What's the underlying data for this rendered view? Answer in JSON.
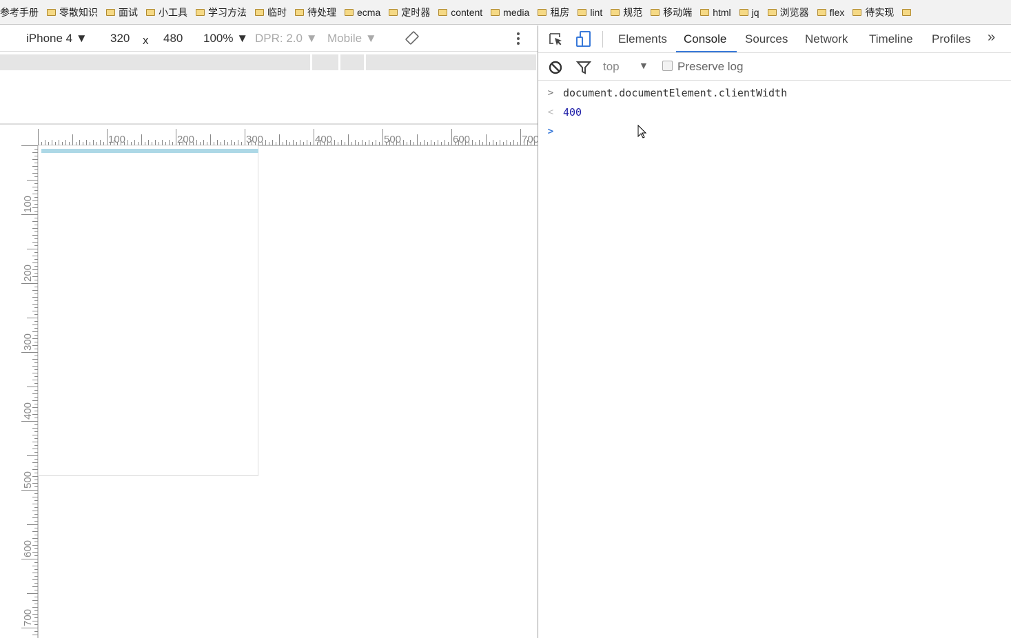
{
  "bookmarks": [
    "参考手册",
    "零散知识",
    "面试",
    "小工具",
    "学习方法",
    "临时",
    "待处理",
    "ecma",
    "定时器",
    "content",
    "media",
    "租房",
    "lint",
    "规范",
    "移动端",
    "html",
    "jq",
    "浏览器",
    "flex",
    "待实现",
    ""
  ],
  "emulator": {
    "device": "iPhone 4",
    "width": "320",
    "times": "x",
    "height": "480",
    "zoom": "100%",
    "dpr": "DPR: 2.0",
    "mode": "Mobile",
    "rotate_icon": "rotate-icon",
    "menu_icon": "kebab-menu-icon"
  },
  "ruler": {
    "h_labels": [
      "100",
      "200",
      "300",
      "400",
      "500",
      "600",
      "700"
    ],
    "v_labels": [
      "100",
      "200",
      "300",
      "400",
      "500",
      "600",
      "700"
    ]
  },
  "devtools": {
    "tabs": [
      "Elements",
      "Console",
      "Sources",
      "Network",
      "Timeline",
      "Profiles"
    ],
    "active_tab": "Console",
    "more": "»",
    "accent": "#3879d9"
  },
  "console_toolbar": {
    "context": "top",
    "preserve_log": "Preserve log",
    "preserve_checked": false
  },
  "console": {
    "input": "document.documentElement.clientWidth",
    "result": "400",
    "input_prompt": ">",
    "result_prompt": "<",
    "result_color": "#1a1aa6"
  }
}
